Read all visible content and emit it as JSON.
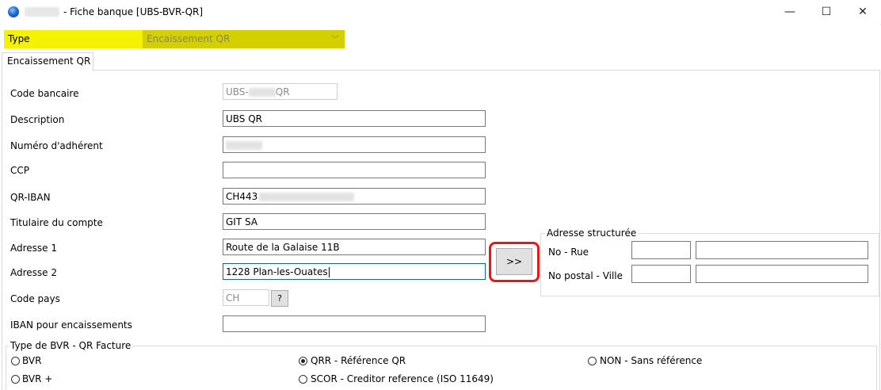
{
  "window": {
    "title": "- Fiche banque [UBS-BVR-QR]",
    "minimize_glyph": "—",
    "maximize_glyph": "☐",
    "close_glyph": "✕"
  },
  "type_row": {
    "label": "Type",
    "value": "Encaissement QR",
    "arrow_glyph": "﹀",
    "highlight_color": "#f5f200"
  },
  "tabs": [
    {
      "label": "Encaissement QR",
      "active": true
    }
  ],
  "form": {
    "code_bancaire": {
      "label": "Code bancaire",
      "prefix": "UBS-",
      "suffix": "QR"
    },
    "description": {
      "label": "Description",
      "value": "UBS QR"
    },
    "numero_adherent": {
      "label": "Numéro d'adhérent",
      "value": ""
    },
    "ccp": {
      "label": "CCP",
      "value": ""
    },
    "qr_iban": {
      "label": "QR-IBAN",
      "value": "CH443"
    },
    "titulaire": {
      "label": "Titulaire du compte",
      "value": "GIT SA"
    },
    "adresse1": {
      "label": "Adresse 1",
      "value": "Route de la Galaise 11B"
    },
    "adresse2": {
      "label": "Adresse 2",
      "value": "1228 Plan-les-Ouates"
    },
    "code_pays": {
      "label": "Code pays",
      "value": "CH",
      "help_label": "?"
    },
    "iban_encaissements": {
      "label": "IBAN pour encaissements",
      "value": ""
    }
  },
  "transfer_button": {
    "label": ">>",
    "highlight_color": "#e81818"
  },
  "adresse_structuree": {
    "title": "Adresse structurée",
    "row1_label": "No - Rue",
    "row2_label": "No postal - Ville",
    "no": "",
    "rue": "",
    "postal": "",
    "ville": ""
  },
  "bvr_group": {
    "title": "Type de BVR - QR Facture",
    "options": [
      {
        "label": "BVR",
        "selected": false
      },
      {
        "label": "QRR - Référence QR",
        "selected": true
      },
      {
        "label": "NON - Sans référence",
        "selected": false
      },
      {
        "label": "BVR +",
        "selected": false
      },
      {
        "label": "SCOR - Creditor reference (ISO 11649)",
        "selected": false
      }
    ]
  }
}
